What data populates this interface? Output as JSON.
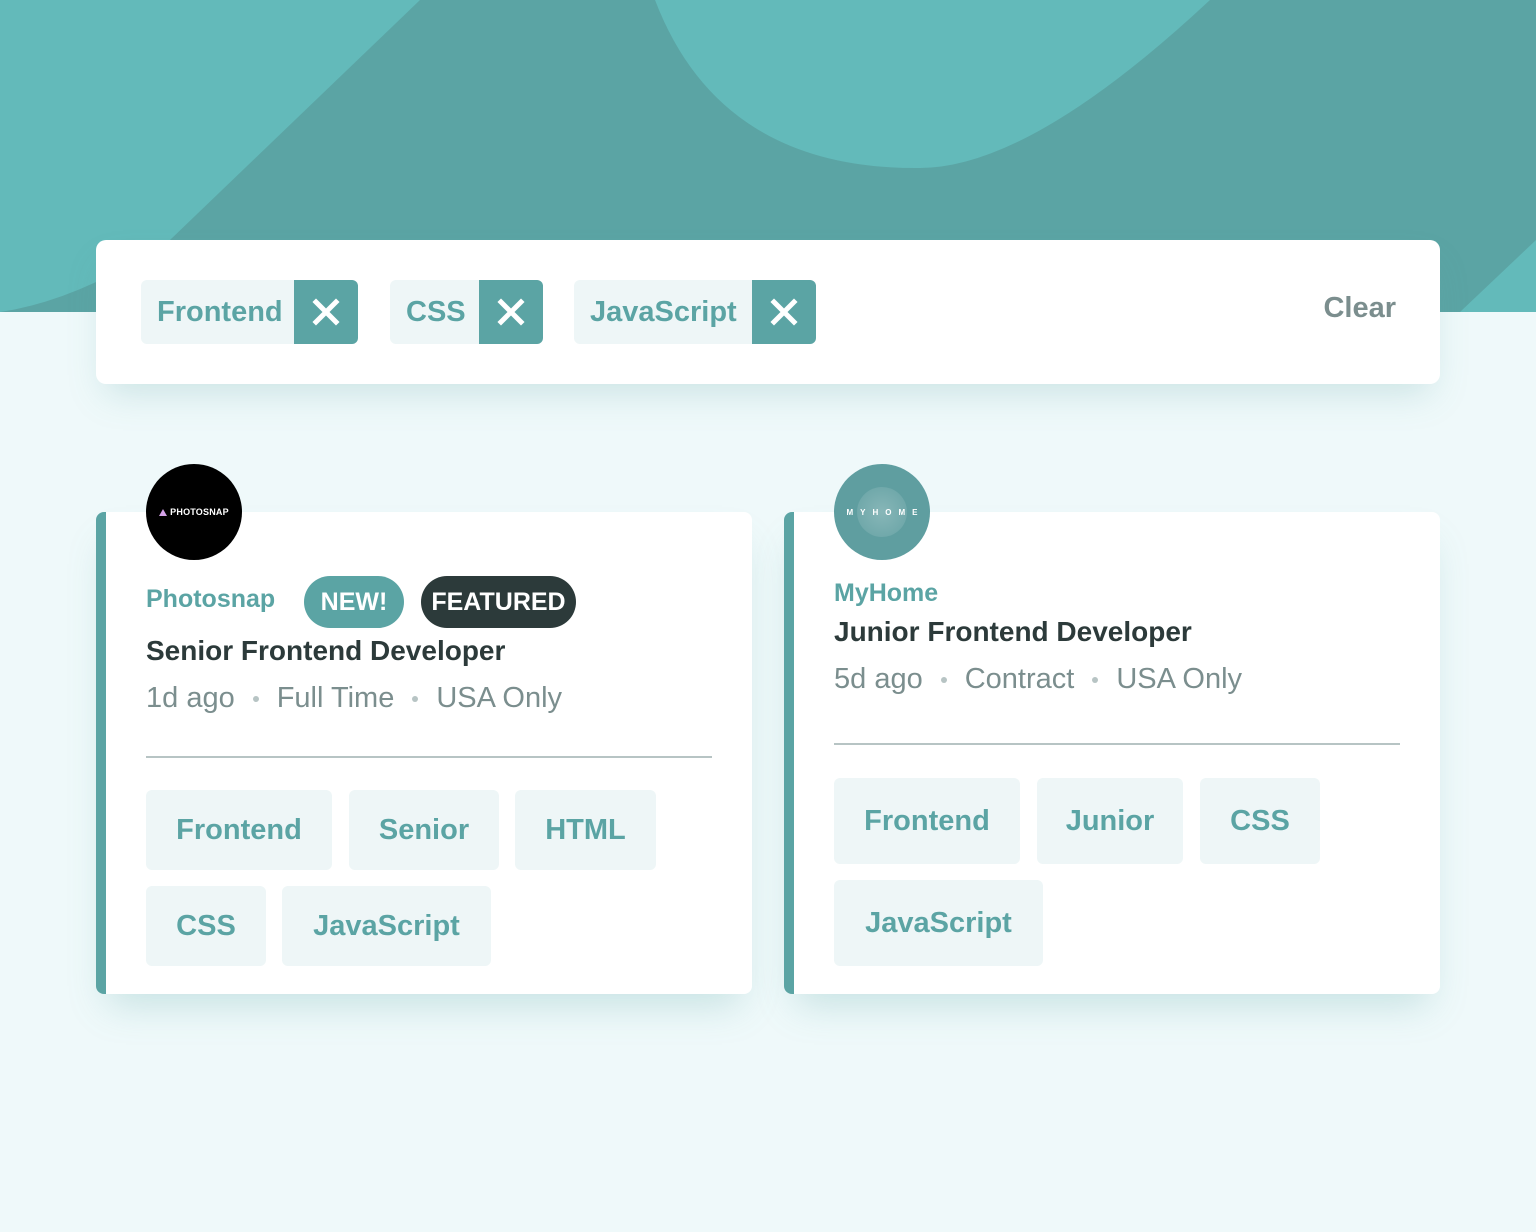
{
  "filters": {
    "chips": [
      {
        "label": "Frontend"
      },
      {
        "label": "CSS"
      },
      {
        "label": "JavaScript"
      }
    ],
    "clear_label": "Clear"
  },
  "jobs": [
    {
      "logo_text": "PHOTOSNAP",
      "company": "Photosnap",
      "badges": [
        "NEW!",
        "FEATURED"
      ],
      "position": "Senior Frontend Developer",
      "posted": "1d ago",
      "contract": "Full Time",
      "location": "USA Only",
      "tags": [
        "Frontend",
        "Senior",
        "HTML",
        "CSS",
        "JavaScript"
      ]
    },
    {
      "logo_text": "MYHOME",
      "company": "MyHome",
      "position": "Junior Frontend Developer",
      "posted": "5d ago",
      "contract": "Contract",
      "location": "USA Only",
      "tags": [
        "Frontend",
        "Junior",
        "CSS",
        "JavaScript"
      ]
    }
  ],
  "colors": {
    "primary": "#5ba4a4",
    "background": "#eff9fa",
    "tag_bg": "#eef6f7",
    "dark": "#2c3a3a",
    "gray": "#7b8e8e"
  },
  "icons": {
    "remove": "close-icon",
    "separator": "dot-icon"
  }
}
